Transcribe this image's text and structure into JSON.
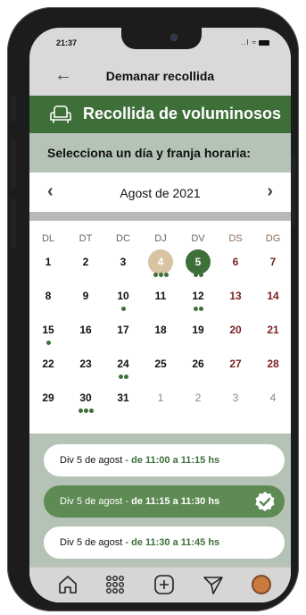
{
  "status": {
    "time": "21:37",
    "signal": "..l"
  },
  "header": {
    "title": "Demanar recollida"
  },
  "banner": {
    "title": "Recollida de voluminosos"
  },
  "subhead": {
    "text": "Selecciona un día y franja horaria:"
  },
  "calendar": {
    "month": "Agost de 2021",
    "weekdays": [
      "DL",
      "DT",
      "DC",
      "DJ",
      "DV",
      "DS",
      "DG"
    ],
    "weeks": [
      [
        {
          "n": "1"
        },
        {
          "n": "2"
        },
        {
          "n": "3"
        },
        {
          "n": "4",
          "state": "tan",
          "dots": 3
        },
        {
          "n": "5",
          "state": "green",
          "dots": 2
        },
        {
          "n": "6",
          "we": true
        },
        {
          "n": "7",
          "we": true
        }
      ],
      [
        {
          "n": "8"
        },
        {
          "n": "9"
        },
        {
          "n": "10",
          "dots": 1
        },
        {
          "n": "11"
        },
        {
          "n": "12",
          "dots": 2
        },
        {
          "n": "13",
          "we": true
        },
        {
          "n": "14",
          "we": true
        }
      ],
      [
        {
          "n": "15",
          "dots": 1
        },
        {
          "n": "16"
        },
        {
          "n": "17"
        },
        {
          "n": "18"
        },
        {
          "n": "19"
        },
        {
          "n": "20",
          "we": true
        },
        {
          "n": "21",
          "we": true
        }
      ],
      [
        {
          "n": "22"
        },
        {
          "n": "23"
        },
        {
          "n": "24",
          "dots": 2
        },
        {
          "n": "25"
        },
        {
          "n": "26"
        },
        {
          "n": "27",
          "we": true
        },
        {
          "n": "28",
          "we": true
        }
      ],
      [
        {
          "n": "29"
        },
        {
          "n": "30",
          "dots": 3
        },
        {
          "n": "31"
        },
        {
          "n": "1",
          "muted": true
        },
        {
          "n": "2",
          "muted": true
        },
        {
          "n": "3",
          "muted": true
        },
        {
          "n": "4",
          "muted": true
        }
      ]
    ]
  },
  "slots": [
    {
      "date": "Div 5 de agost",
      "sep": " - ",
      "time": "de 11:00 a 11:15 hs",
      "selected": false
    },
    {
      "date": "Div 5 de agost",
      "sep": " - ",
      "time": "de 11:15 a 11:30 hs",
      "selected": true
    },
    {
      "date": "Div 5 de agost",
      "sep": " - ",
      "time": "de 11:30 a 11:45 hs",
      "selected": false
    }
  ],
  "colors": {
    "brand_green": "#3e6f39",
    "slot_selected": "#5e8a53",
    "highlight_tan": "#d9c3a2",
    "weekend_red": "#7a1f1f"
  },
  "tabbar": {
    "icons": [
      "home-icon",
      "apps-grid-icon",
      "add-icon",
      "send-icon",
      "profile-avatar"
    ]
  }
}
